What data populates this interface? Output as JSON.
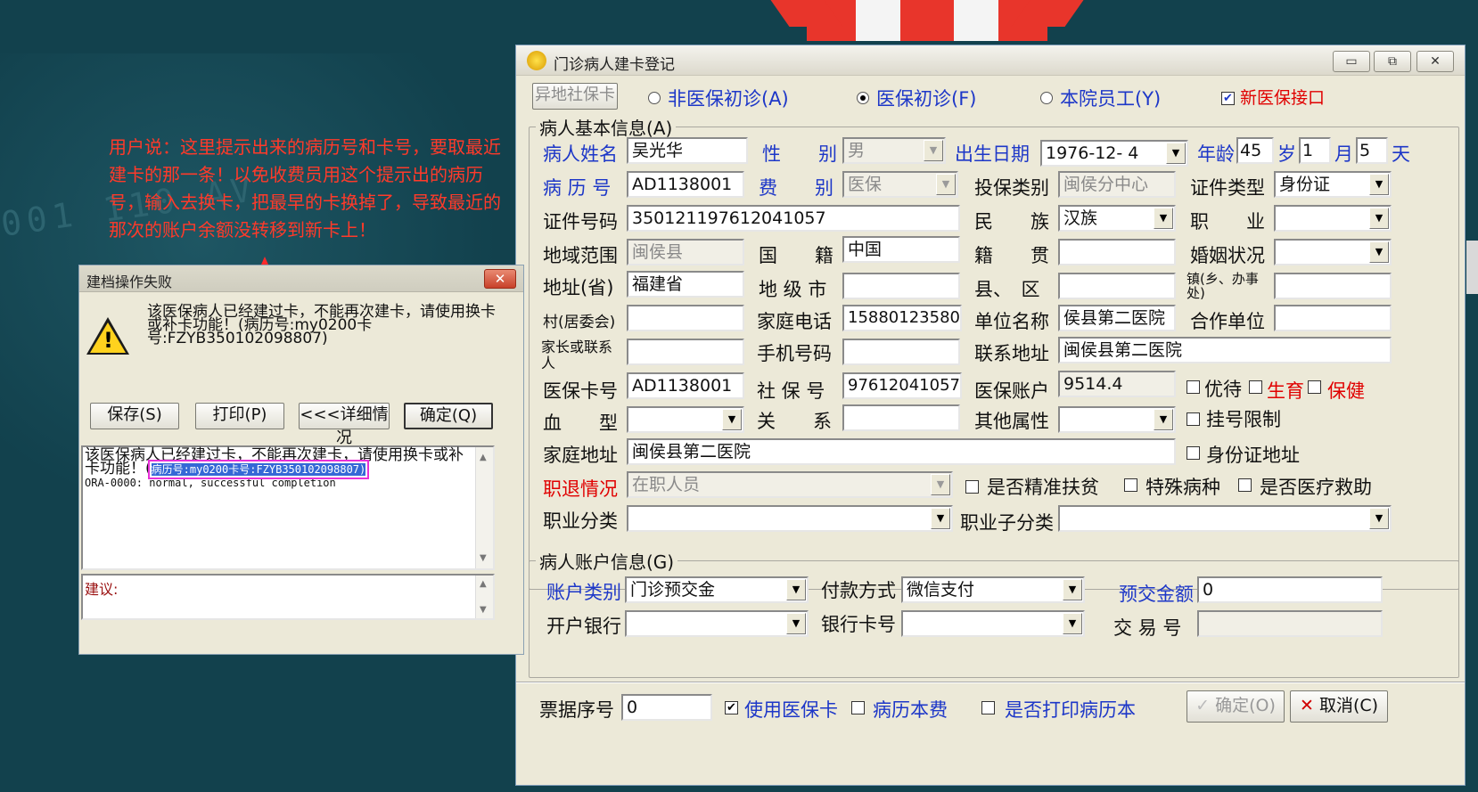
{
  "annotation": {
    "text": "用户说：这里提示出来的病历号和卡号，要取最近建卡的那一条！以免收费员用这个提示出的病历号，输入去换卡，把最早的卡换掉了，导致最近的那次的账户余额没转移到新卡上！"
  },
  "background": {
    "digits": "001 110 AV"
  },
  "error_dialog": {
    "title": "建档操作失败",
    "close": "✕",
    "message_line1": "该医保病人已经建过卡，不能再次建卡，请使用换卡",
    "message_line2": "或补卡功能！(病历号:my0200卡",
    "message_line3": "号:FZYB350102098807)",
    "buttons": {
      "save": "保存(S)",
      "print": "打印(P)",
      "details": "<<<详细情况",
      "ok": "确定(Q)"
    },
    "detail_line1": "该医保病人已经建过卡，不能再次建卡，请使用换卡或补",
    "detail_line2_prefix": "卡功能！(",
    "detail_highlight": "病历号:my0200卡号:FZYB350102098807)",
    "detail_line3": "ORA-0000: normal, successful completion",
    "suggestion_label": "建议:"
  },
  "main": {
    "title": "门诊病人建卡登记",
    "window_buttons": {
      "min": "▭",
      "max": "⧉",
      "close": "✕"
    },
    "top_bar": {
      "remote_card": "异地社保卡",
      "opt_non_insured": "非医保初诊(A)",
      "opt_insured": "医保初诊(F)",
      "opt_staff": "本院员工(Y)",
      "new_interface": "新医保接口"
    },
    "basic_info_title": "病人基本信息(A)",
    "fields": {
      "name_label": "病人姓名",
      "name": "吴光华",
      "sex_label": "性　　别",
      "sex": "男",
      "birth_label": "出生日期",
      "birth": "1976-12- 4",
      "age_label": "年龄",
      "age": "45",
      "age_unit": "岁",
      "month": "1",
      "month_unit": "月",
      "day": "5",
      "day_unit": "天",
      "record_label": "病 历 号",
      "record": "AD1138001",
      "fee_label": "费　　别",
      "fee": "医保",
      "insure_type_label": "投保类别",
      "insure_type": "闽侯分中心",
      "id_type_label": "证件类型",
      "id_type": "身份证",
      "id_no_label": "证件号码",
      "id_no": "350121197612041057",
      "ethnic_label": "民　　族",
      "ethnic": "汉族",
      "job_label": "职　　业",
      "job": "",
      "region_label": "地域范围",
      "region": "闽侯县",
      "nation_label": "国　　籍",
      "nation": "中国",
      "native_label": "籍　　贯",
      "native": "",
      "marital_label": "婚姻状况",
      "marital": "",
      "province_label": "地址(省)",
      "province": "福建省",
      "city_label": "地 级 市",
      "city": "",
      "county_label": "县、　区",
      "county": "",
      "town_label": "镇(乡、办事处)",
      "town": "",
      "village_label": "村(居委会)",
      "village": "",
      "home_phone_label": "家庭电话",
      "home_phone": "15880123580",
      "employer_label": "单位名称",
      "employer": "侯县第二医院",
      "coop_label": "合作单位",
      "coop": "",
      "guardian_label": "家长或联系人",
      "guardian": "",
      "mobile_label": "手机号码",
      "mobile": "",
      "contact_addr_label": "联系地址",
      "contact_addr": "闽侯县第二医院",
      "card_label": "医保卡号",
      "card": "AD1138001",
      "ss_label": "社 保 号",
      "ss": "97612041057",
      "account_label": "医保账户",
      "account": "9514.4",
      "chk_priority": "优待",
      "chk_birth": "生育",
      "chk_care": "保健",
      "blood_label": "血　　型",
      "blood": "",
      "relation_label": "关　　系",
      "relation": "",
      "other_label": "其他属性",
      "other": "",
      "reg_limit": "挂号限制",
      "home_addr_label": "家庭地址",
      "home_addr": "闽侯县第二医院",
      "id_addr": "身份证地址",
      "retire_label": "职退情况",
      "retire": "在职人员",
      "poverty": "是否精准扶贫",
      "special": "特殊病种",
      "aid": "是否医疗救助",
      "occ_class_label": "职业分类",
      "occ_class": "",
      "occ_sub_label": "职业子分类",
      "occ_sub": ""
    },
    "account_info": {
      "title": "病人账户信息(G)",
      "type_label": "账户类别",
      "type": "门诊预交金",
      "pay_label": "付款方式",
      "pay": "微信支付",
      "prepay_label": "预交金额",
      "prepay": "0",
      "bank_label": "开户银行",
      "bank": "",
      "bank_card_label": "银行卡号",
      "bank_card": "",
      "trade_label": "交 易 号",
      "trade": ""
    },
    "bottom": {
      "receipt_label": "票据序号",
      "receipt": "0",
      "use_card": "使用医保卡",
      "record_fee": "病历本费",
      "print_record": "是否打印病历本",
      "ok": "确定(O)",
      "cancel": "取消(C)"
    }
  }
}
